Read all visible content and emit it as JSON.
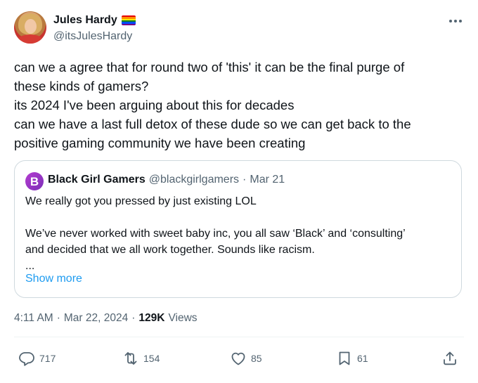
{
  "author": {
    "display_name": "Jules Hardy",
    "handle": "@itsJulesHardy",
    "badge_icon": "rainbow-flag-icon",
    "flag_colors": [
      "#e40303",
      "#ff8c00",
      "#ffed00",
      "#008026",
      "#004dff",
      "#750787"
    ]
  },
  "tweet": {
    "lines": [
      "can we a agree that for round two of 'this' it can be the final purge of",
      "these kinds of gamers?",
      "its 2024 I've been arguing about this for decades",
      "can we have a last full detox of these dude so we can get back to the",
      "positive gaming community we have been creating"
    ]
  },
  "quote": {
    "avatar_letter": "B",
    "display_name": "Black Girl Gamers",
    "handle": "@blackgirlgamers",
    "separator": "·",
    "date": "Mar 21",
    "lines": [
      "We really got you pressed by just existing LOL",
      "",
      "We’ve never worked with sweet baby inc, you all saw ‘Black’ and ‘consulting’",
      "and decided that we all work together. Sounds like racism.",
      "..."
    ],
    "show_more": "Show more"
  },
  "meta": {
    "time": "4:11 AM",
    "separator": "·",
    "date": "Mar 22, 2024",
    "views_count": "129K",
    "views_label": "Views"
  },
  "actions": {
    "replies": "717",
    "reposts": "154",
    "likes": "85",
    "bookmarks": "61"
  },
  "colors": {
    "accent": "#1d9bf0",
    "secondary_text": "#536471",
    "primary_text": "#0f1419",
    "border": "#cfd9de"
  }
}
